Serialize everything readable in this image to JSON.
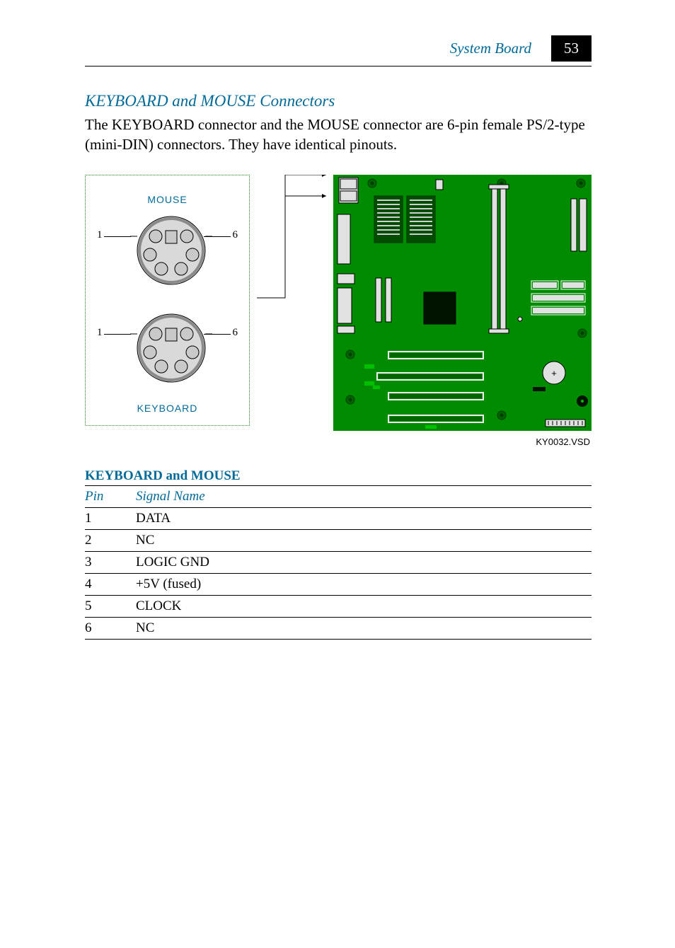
{
  "header": {
    "title": "System Board",
    "page_number": "53"
  },
  "section": {
    "heading": "KEYBOARD and MOUSE Connectors",
    "body": "The KEYBOARD connector and the MOUSE connector are 6-pin female PS/2-type (mini-DIN) connectors. They have identical pinouts."
  },
  "figure": {
    "mouse_label": "MOUSE",
    "keyboard_label": "KEYBOARD",
    "pin1": "1",
    "pin6": "6",
    "caption": "KY0032.VSD"
  },
  "table": {
    "title": "KEYBOARD and MOUSE",
    "headers": {
      "pin": "Pin",
      "signal": "Signal Name"
    },
    "rows": [
      {
        "pin": "1",
        "signal": "DATA"
      },
      {
        "pin": "2",
        "signal": "NC"
      },
      {
        "pin": "3",
        "signal": "LOGIC GND"
      },
      {
        "pin": "4",
        "signal": "+5V (fused)"
      },
      {
        "pin": "5",
        "signal": "CLOCK"
      },
      {
        "pin": "6",
        "signal": "NC"
      }
    ]
  }
}
